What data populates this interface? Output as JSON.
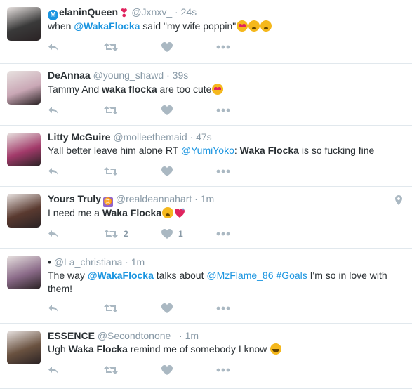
{
  "tweets": [
    {
      "name": "elaninQueen",
      "name_prefix": "M",
      "handle": "@Jxnxv_",
      "time": "24s",
      "body": [
        {
          "t": "when ",
          "s": "text"
        },
        {
          "t": "@WakaFlocka",
          "s": "mention-bold"
        },
        {
          "t": " said \"my wife poppin\"",
          "s": "text"
        }
      ],
      "emojis": [
        "heart-eyes-emoji",
        "weary-emoji",
        "weary-emoji"
      ],
      "retweets": "",
      "likes": "",
      "avatar_color": "#3a3a3a"
    },
    {
      "name": "DeAnnaa",
      "handle": "@young_shawd",
      "time": "39s",
      "body": [
        {
          "t": "Tammy And ",
          "s": "text"
        },
        {
          "t": "waka flocka",
          "s": "bold"
        },
        {
          "t": " are too cute",
          "s": "text"
        }
      ],
      "emojis": [
        "heart-eyes-emoji"
      ],
      "retweets": "",
      "likes": "",
      "avatar_color": "#c9a7b5"
    },
    {
      "name": "Litty McGuire",
      "handle": "@molleethemaid",
      "time": "47s",
      "body": [
        {
          "t": "Yall better leave him alone RT ",
          "s": "text"
        },
        {
          "t": "@YumiYoko",
          "s": "mention"
        },
        {
          "t": ": ",
          "s": "text"
        },
        {
          "t": "Waka Flocka",
          "s": "bold"
        },
        {
          "t": " is so fucking fine",
          "s": "text"
        }
      ],
      "emojis": [],
      "retweets": "",
      "likes": "",
      "avatar_color": "#a23a6a"
    },
    {
      "name": "Yours Truly",
      "zodiac": "♊",
      "handle": "@realdeannahart",
      "time": "1m",
      "body": [
        {
          "t": "I need me a ",
          "s": "text"
        },
        {
          "t": "Waka Flocka",
          "s": "bold"
        }
      ],
      "emojis": [
        "weary-emoji",
        "sparkling-heart-emoji"
      ],
      "retweets": "2",
      "likes": "1",
      "avatar_color": "#5a3a30"
    },
    {
      "name": "•",
      "handle": "@La_christiana",
      "time": "1m",
      "body": [
        {
          "t": "The way ",
          "s": "text"
        },
        {
          "t": "@WakaFlocka",
          "s": "mention-bold"
        },
        {
          "t": " talks about ",
          "s": "text"
        },
        {
          "t": "@MzFlame_86",
          "s": "mention"
        },
        {
          "t": " ",
          "s": "text"
        },
        {
          "t": "#Goals",
          "s": "mention"
        },
        {
          "t": " I'm so in love with them!",
          "s": "text"
        }
      ],
      "emojis": [],
      "retweets": "",
      "likes": "",
      "avatar_color": "#8a6a88"
    },
    {
      "name": "ESSENCE",
      "handle": "@Secondtonone_",
      "time": "1m",
      "body": [
        {
          "t": "Ugh ",
          "s": "text"
        },
        {
          "t": "Waka Flocka",
          "s": "bold"
        },
        {
          "t": " remind me of somebody I know ",
          "s": "text"
        }
      ],
      "emojis": [
        "tears-of-joy-emoji"
      ],
      "retweets": "",
      "likes": "",
      "avatar_color": "#6a5240"
    }
  ],
  "colors": {
    "text": "#292f33",
    "meta": "#8899a6",
    "link": "#1b95e0",
    "icon": "#aab8c2",
    "divider": "#e1e8ed"
  },
  "icons": {
    "reply": "reply-icon",
    "retweet": "retweet-icon",
    "like": "heart-icon",
    "more": "more-icon",
    "location": "location-pin-icon"
  }
}
